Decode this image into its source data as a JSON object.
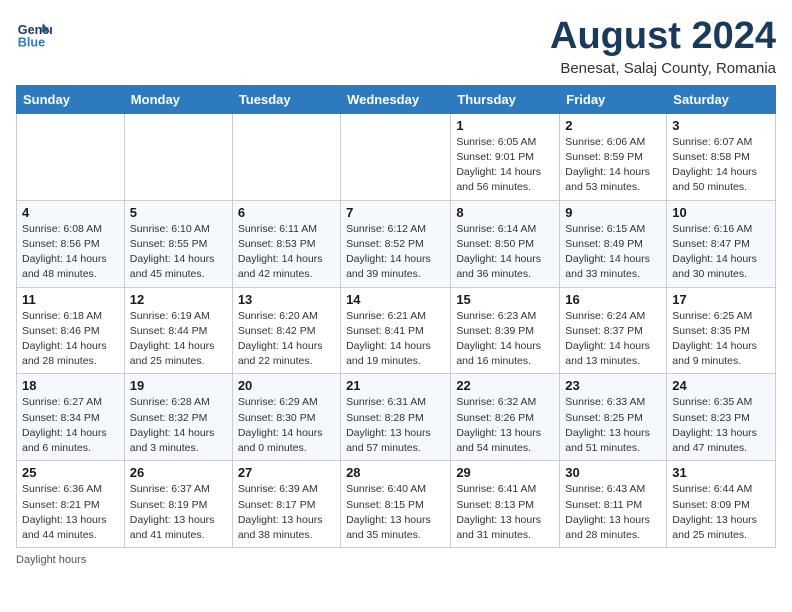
{
  "logo": {
    "line1": "General",
    "line2": "Blue"
  },
  "title": "August 2024",
  "subtitle": "Benesat, Salaj County, Romania",
  "weekdays": [
    "Sunday",
    "Monday",
    "Tuesday",
    "Wednesday",
    "Thursday",
    "Friday",
    "Saturday"
  ],
  "footer": "Daylight hours",
  "weeks": [
    [
      {
        "day": "",
        "detail": ""
      },
      {
        "day": "",
        "detail": ""
      },
      {
        "day": "",
        "detail": ""
      },
      {
        "day": "",
        "detail": ""
      },
      {
        "day": "1",
        "detail": "Sunrise: 6:05 AM\nSunset: 9:01 PM\nDaylight: 14 hours\nand 56 minutes."
      },
      {
        "day": "2",
        "detail": "Sunrise: 6:06 AM\nSunset: 8:59 PM\nDaylight: 14 hours\nand 53 minutes."
      },
      {
        "day": "3",
        "detail": "Sunrise: 6:07 AM\nSunset: 8:58 PM\nDaylight: 14 hours\nand 50 minutes."
      }
    ],
    [
      {
        "day": "4",
        "detail": "Sunrise: 6:08 AM\nSunset: 8:56 PM\nDaylight: 14 hours\nand 48 minutes."
      },
      {
        "day": "5",
        "detail": "Sunrise: 6:10 AM\nSunset: 8:55 PM\nDaylight: 14 hours\nand 45 minutes."
      },
      {
        "day": "6",
        "detail": "Sunrise: 6:11 AM\nSunset: 8:53 PM\nDaylight: 14 hours\nand 42 minutes."
      },
      {
        "day": "7",
        "detail": "Sunrise: 6:12 AM\nSunset: 8:52 PM\nDaylight: 14 hours\nand 39 minutes."
      },
      {
        "day": "8",
        "detail": "Sunrise: 6:14 AM\nSunset: 8:50 PM\nDaylight: 14 hours\nand 36 minutes."
      },
      {
        "day": "9",
        "detail": "Sunrise: 6:15 AM\nSunset: 8:49 PM\nDaylight: 14 hours\nand 33 minutes."
      },
      {
        "day": "10",
        "detail": "Sunrise: 6:16 AM\nSunset: 8:47 PM\nDaylight: 14 hours\nand 30 minutes."
      }
    ],
    [
      {
        "day": "11",
        "detail": "Sunrise: 6:18 AM\nSunset: 8:46 PM\nDaylight: 14 hours\nand 28 minutes."
      },
      {
        "day": "12",
        "detail": "Sunrise: 6:19 AM\nSunset: 8:44 PM\nDaylight: 14 hours\nand 25 minutes."
      },
      {
        "day": "13",
        "detail": "Sunrise: 6:20 AM\nSunset: 8:42 PM\nDaylight: 14 hours\nand 22 minutes."
      },
      {
        "day": "14",
        "detail": "Sunrise: 6:21 AM\nSunset: 8:41 PM\nDaylight: 14 hours\nand 19 minutes."
      },
      {
        "day": "15",
        "detail": "Sunrise: 6:23 AM\nSunset: 8:39 PM\nDaylight: 14 hours\nand 16 minutes."
      },
      {
        "day": "16",
        "detail": "Sunrise: 6:24 AM\nSunset: 8:37 PM\nDaylight: 14 hours\nand 13 minutes."
      },
      {
        "day": "17",
        "detail": "Sunrise: 6:25 AM\nSunset: 8:35 PM\nDaylight: 14 hours\nand 9 minutes."
      }
    ],
    [
      {
        "day": "18",
        "detail": "Sunrise: 6:27 AM\nSunset: 8:34 PM\nDaylight: 14 hours\nand 6 minutes."
      },
      {
        "day": "19",
        "detail": "Sunrise: 6:28 AM\nSunset: 8:32 PM\nDaylight: 14 hours\nand 3 minutes."
      },
      {
        "day": "20",
        "detail": "Sunrise: 6:29 AM\nSunset: 8:30 PM\nDaylight: 14 hours\nand 0 minutes."
      },
      {
        "day": "21",
        "detail": "Sunrise: 6:31 AM\nSunset: 8:28 PM\nDaylight: 13 hours\nand 57 minutes."
      },
      {
        "day": "22",
        "detail": "Sunrise: 6:32 AM\nSunset: 8:26 PM\nDaylight: 13 hours\nand 54 minutes."
      },
      {
        "day": "23",
        "detail": "Sunrise: 6:33 AM\nSunset: 8:25 PM\nDaylight: 13 hours\nand 51 minutes."
      },
      {
        "day": "24",
        "detail": "Sunrise: 6:35 AM\nSunset: 8:23 PM\nDaylight: 13 hours\nand 47 minutes."
      }
    ],
    [
      {
        "day": "25",
        "detail": "Sunrise: 6:36 AM\nSunset: 8:21 PM\nDaylight: 13 hours\nand 44 minutes."
      },
      {
        "day": "26",
        "detail": "Sunrise: 6:37 AM\nSunset: 8:19 PM\nDaylight: 13 hours\nand 41 minutes."
      },
      {
        "day": "27",
        "detail": "Sunrise: 6:39 AM\nSunset: 8:17 PM\nDaylight: 13 hours\nand 38 minutes."
      },
      {
        "day": "28",
        "detail": "Sunrise: 6:40 AM\nSunset: 8:15 PM\nDaylight: 13 hours\nand 35 minutes."
      },
      {
        "day": "29",
        "detail": "Sunrise: 6:41 AM\nSunset: 8:13 PM\nDaylight: 13 hours\nand 31 minutes."
      },
      {
        "day": "30",
        "detail": "Sunrise: 6:43 AM\nSunset: 8:11 PM\nDaylight: 13 hours\nand 28 minutes."
      },
      {
        "day": "31",
        "detail": "Sunrise: 6:44 AM\nSunset: 8:09 PM\nDaylight: 13 hours\nand 25 minutes."
      }
    ]
  ]
}
